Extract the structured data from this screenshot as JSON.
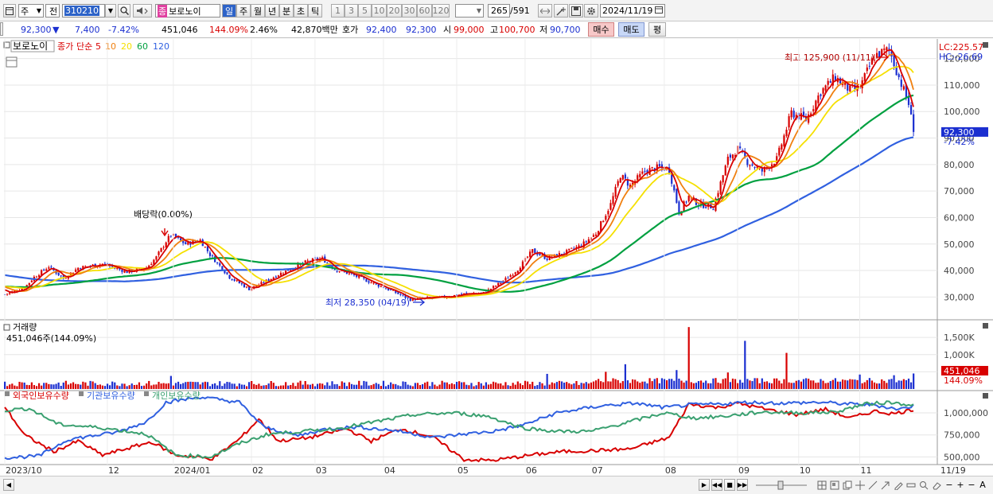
{
  "toolbar": {
    "market": "주",
    "mode": "전",
    "code": "310210",
    "name_badge": "종",
    "name": "보로노이",
    "periods": [
      "일",
      "주",
      "월",
      "년",
      "분",
      "초",
      "틱"
    ],
    "active_period": "일",
    "minute_opts": [
      "1",
      "3",
      "5",
      "10",
      "20",
      "30",
      "60",
      "120"
    ],
    "count": "265",
    "total": "/591",
    "date": "2024/11/19"
  },
  "quote": {
    "price": "92,300",
    "arrow": "▼",
    "change": "7,400",
    "rate": "-7.42%",
    "volume": "451,046",
    "vol_rate": "144.09%",
    "turnover": "2.46%",
    "amount": "42,870백만",
    "ask_label": "호가",
    "ask1": "92,400",
    "ask2": "92,300",
    "open_label": "시",
    "open": "99,000",
    "high_label": "고",
    "high": "100,700",
    "low_label": "저",
    "low": "90,700",
    "buy": "매수",
    "sell": "매도",
    "flat": "평"
  },
  "colors": {
    "up": "#d80000",
    "down": "#1b2fd0",
    "ma5": "#d80000",
    "ma10": "#f08010",
    "ma20": "#f5e000",
    "ma60": "#00a040",
    "ma120": "#3060e0",
    "foreign": "#d80000",
    "inst": "#3060e0",
    "indiv": "#3aa070"
  },
  "chart_data": [
    {
      "type": "candlestick",
      "title": "보로노이",
      "legend": [
        {
          "name": "종가",
          "color": "#d80000"
        },
        {
          "name": "단순",
          "color": "#d80000"
        },
        {
          "name": "5",
          "color": "#d80000"
        },
        {
          "name": "10",
          "color": "#f08010"
        },
        {
          "name": "20",
          "color": "#f5e000"
        },
        {
          "name": "60",
          "color": "#00a040"
        },
        {
          "name": "120",
          "color": "#3060e0"
        }
      ],
      "y_ticks": [
        30000,
        40000,
        50000,
        60000,
        70000,
        80000,
        90000,
        100000,
        110000,
        120000
      ],
      "y_tick_labels": [
        "30,000",
        "40,000",
        "50,000",
        "60,000",
        "70,000",
        "80,000",
        "90,000",
        "100,000",
        "110,000",
        "120,000"
      ],
      "ylim": [
        22000,
        126500
      ],
      "x_ticks": [
        {
          "i": 0,
          "label": "2023/10"
        },
        {
          "i": 42,
          "label": "12"
        },
        {
          "i": 69,
          "label": "2024/01"
        },
        {
          "i": 101,
          "label": "02"
        },
        {
          "i": 127,
          "label": "03"
        },
        {
          "i": 155,
          "label": "04"
        },
        {
          "i": 185,
          "label": "05"
        },
        {
          "i": 213,
          "label": "06"
        },
        {
          "i": 240,
          "label": "07"
        },
        {
          "i": 270,
          "label": "08"
        },
        {
          "i": 300,
          "label": "09"
        },
        {
          "i": 325,
          "label": "10"
        },
        {
          "i": 350,
          "label": "11"
        },
        {
          "i": 380,
          "label": "11/19"
        }
      ],
      "anchors": [
        [
          0,
          31000
        ],
        [
          8,
          33500
        ],
        [
          12,
          37500
        ],
        [
          18,
          41500
        ],
        [
          24,
          37000
        ],
        [
          30,
          41000
        ],
        [
          40,
          42500
        ],
        [
          50,
          39500
        ],
        [
          58,
          41000
        ],
        [
          62,
          45000
        ],
        [
          66,
          51000
        ],
        [
          68,
          53500
        ],
        [
          74,
          50000
        ],
        [
          80,
          51500
        ],
        [
          84,
          46000
        ],
        [
          92,
          37500
        ],
        [
          100,
          33000
        ],
        [
          106,
          35500
        ],
        [
          112,
          38500
        ],
        [
          118,
          41000
        ],
        [
          124,
          43500
        ],
        [
          130,
          44500
        ],
        [
          135,
          40500
        ],
        [
          142,
          38500
        ],
        [
          150,
          35500
        ],
        [
          158,
          32500
        ],
        [
          166,
          29000
        ],
        [
          172,
          29500
        ],
        [
          180,
          30000
        ],
        [
          188,
          31200
        ],
        [
          196,
          31500
        ],
        [
          204,
          36000
        ],
        [
          210,
          40500
        ],
        [
          216,
          47500
        ],
        [
          222,
          44500
        ],
        [
          230,
          47000
        ],
        [
          236,
          49500
        ],
        [
          242,
          54000
        ],
        [
          248,
          65000
        ],
        [
          252,
          76000
        ],
        [
          256,
          72000
        ],
        [
          262,
          77500
        ],
        [
          268,
          79000
        ],
        [
          272,
          78000
        ],
        [
          276,
          62000
        ],
        [
          280,
          68000
        ],
        [
          284,
          65000
        ],
        [
          290,
          64000
        ],
        [
          296,
          82000
        ],
        [
          300,
          86000
        ],
        [
          304,
          81000
        ],
        [
          310,
          77500
        ],
        [
          316,
          82000
        ],
        [
          322,
          99500
        ],
        [
          328,
          97000
        ],
        [
          334,
          107500
        ],
        [
          340,
          113000
        ],
        [
          346,
          108000
        ],
        [
          350,
          109000
        ],
        [
          356,
          121000
        ],
        [
          362,
          123500
        ],
        [
          366,
          113000
        ],
        [
          370,
          103000
        ],
        [
          372,
          92300
        ]
      ],
      "n_days": 373,
      "seed": 7,
      "ma_periods": [
        5,
        10,
        20,
        60,
        120
      ],
      "annotations": {
        "high": "최고 125,900 (11/11)",
        "low": "최저 28,350 (04/19)",
        "dividend": "배당락(0.00%)",
        "lc": "LC:225.57",
        "hc": "HC:-26.69",
        "price_tag": "92,300",
        "price_rate": "-7.42%"
      }
    },
    {
      "type": "bar",
      "title": "거래량",
      "info": "451,046주(144.09%)",
      "y_ticks": [
        500000,
        1000000,
        1500000
      ],
      "y_tick_labels": [
        "500K",
        "1,000K",
        "1,500K"
      ],
      "ylim": [
        0,
        1850000
      ],
      "spikes": [
        {
          "i": 280,
          "v": 1800000
        },
        {
          "i": 303,
          "v": 1400000
        },
        {
          "i": 320,
          "v": 1050000
        },
        {
          "i": 254,
          "v": 720000
        },
        {
          "i": 246,
          "v": 500000
        },
        {
          "i": 296,
          "v": 480000
        },
        {
          "i": 275,
          "v": 550000
        },
        {
          "i": 350,
          "v": 420000
        },
        {
          "i": 222,
          "v": 440000
        },
        {
          "i": 68,
          "v": 380000
        },
        {
          "i": 364,
          "v": 400000
        },
        {
          "i": 372,
          "v": 451046
        }
      ],
      "tag": "451,046",
      "tag_rate": "144.09%"
    },
    {
      "type": "line",
      "series": [
        {
          "name": "외국인보유수량",
          "color": "#d80000"
        },
        {
          "name": "기관보유수량",
          "color": "#3060e0"
        },
        {
          "name": "개인보유수량",
          "color": "#3aa070"
        }
      ],
      "y_ticks": [
        500000,
        750000,
        1000000
      ],
      "y_tick_labels": [
        "500,000",
        "750,000",
        "1,000,000"
      ],
      "ylim": [
        440000,
        1190000
      ],
      "anchors": {
        "foreign": [
          [
            0,
            1070000
          ],
          [
            8,
            750000
          ],
          [
            20,
            560000
          ],
          [
            30,
            680000
          ],
          [
            40,
            520000
          ],
          [
            60,
            670000
          ],
          [
            70,
            520000
          ],
          [
            85,
            480000
          ],
          [
            96,
            700000
          ],
          [
            104,
            930000
          ],
          [
            112,
            680000
          ],
          [
            125,
            720000
          ],
          [
            140,
            820000
          ],
          [
            150,
            680000
          ],
          [
            162,
            820000
          ],
          [
            175,
            730000
          ],
          [
            188,
            470000
          ],
          [
            200,
            460000
          ],
          [
            215,
            520000
          ],
          [
            228,
            560000
          ],
          [
            240,
            570000
          ],
          [
            256,
            590000
          ],
          [
            272,
            720000
          ],
          [
            280,
            1100000
          ],
          [
            292,
            1060000
          ],
          [
            300,
            1110000
          ],
          [
            312,
            1040000
          ],
          [
            324,
            980000
          ],
          [
            336,
            1040000
          ],
          [
            346,
            940000
          ],
          [
            356,
            1020000
          ],
          [
            364,
            990000
          ],
          [
            372,
            1040000
          ]
        ],
        "inst": [
          [
            0,
            490000
          ],
          [
            14,
            510000
          ],
          [
            26,
            700000
          ],
          [
            46,
            780000
          ],
          [
            58,
            900000
          ],
          [
            66,
            1120000
          ],
          [
            80,
            1180000
          ],
          [
            96,
            1120000
          ],
          [
            106,
            840000
          ],
          [
            120,
            740000
          ],
          [
            132,
            820000
          ],
          [
            144,
            840000
          ],
          [
            160,
            800000
          ],
          [
            176,
            720000
          ],
          [
            188,
            760000
          ],
          [
            200,
            790000
          ],
          [
            212,
            860000
          ],
          [
            226,
            1000000
          ],
          [
            244,
            1080000
          ],
          [
            258,
            1110000
          ],
          [
            270,
            1060000
          ],
          [
            280,
            1090000
          ],
          [
            292,
            1100000
          ],
          [
            304,
            1120000
          ],
          [
            318,
            1110000
          ],
          [
            334,
            1120000
          ],
          [
            346,
            1100000
          ],
          [
            356,
            1090000
          ],
          [
            366,
            1040000
          ],
          [
            372,
            1080000
          ]
        ],
        "indiv": [
          [
            0,
            1030000
          ],
          [
            10,
            1050000
          ],
          [
            22,
            870000
          ],
          [
            40,
            830000
          ],
          [
            58,
            760000
          ],
          [
            70,
            520000
          ],
          [
            84,
            500000
          ],
          [
            96,
            650000
          ],
          [
            108,
            760000
          ],
          [
            122,
            790000
          ],
          [
            136,
            820000
          ],
          [
            152,
            900000
          ],
          [
            168,
            980000
          ],
          [
            184,
            1000000
          ],
          [
            198,
            960000
          ],
          [
            212,
            830000
          ],
          [
            226,
            790000
          ],
          [
            240,
            790000
          ],
          [
            256,
            900000
          ],
          [
            270,
            1000000
          ],
          [
            282,
            940000
          ],
          [
            294,
            960000
          ],
          [
            310,
            1010000
          ],
          [
            326,
            1000000
          ],
          [
            340,
            1010000
          ],
          [
            352,
            1100000
          ],
          [
            362,
            1120000
          ],
          [
            372,
            1090000
          ]
        ]
      }
    }
  ],
  "status": {
    "minus": "−",
    "plus": "+",
    "label_a": "A"
  }
}
